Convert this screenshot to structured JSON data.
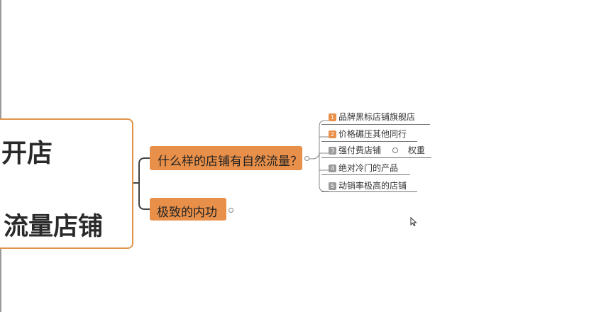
{
  "central": {
    "line1": "开店",
    "line2": "流量店铺"
  },
  "topics": [
    {
      "label": "什么样的店铺有自然流量？"
    },
    {
      "label": "极致的内功"
    }
  ],
  "subtopics": [
    {
      "badge": "1",
      "label": "品牌黑标店铺旗舰店",
      "badge_color": "#e8904a"
    },
    {
      "badge": "2",
      "label": "价格碾压其他同行",
      "badge_color": "#e8904a"
    },
    {
      "badge": "3",
      "label": "强付费店铺",
      "badge_color": "#9a9a9a",
      "extra": "权重"
    },
    {
      "badge": "4",
      "label": "绝对冷门的产品",
      "badge_color": "#9a9a9a"
    },
    {
      "badge": "5",
      "label": "动销率极高的店铺",
      "badge_color": "#9a9a9a"
    }
  ],
  "colors": {
    "accent": "#e8904a",
    "border": "#e0944a",
    "text": "#2a2a2a"
  }
}
